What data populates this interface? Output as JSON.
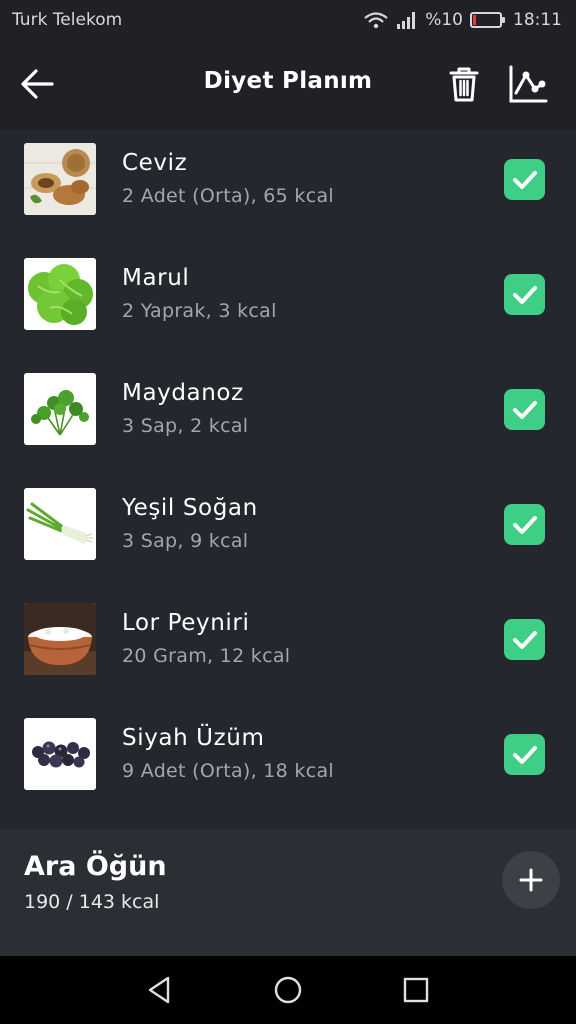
{
  "status_bar": {
    "carrier": "Turk Telekom",
    "battery_text": "%10",
    "battery_level": 0.1,
    "time": "18:11"
  },
  "header": {
    "title": "Diyet Planım",
    "back_icon": "arrow-left-icon",
    "delete_icon": "trash-icon",
    "stats_icon": "line-chart-icon"
  },
  "foods": [
    {
      "name": "Ceviz",
      "detail": "2 Adet (Orta), 65 kcal",
      "checked": true,
      "image": "walnut"
    },
    {
      "name": "Marul",
      "detail": "2 Yaprak, 3 kcal",
      "checked": true,
      "image": "lettuce"
    },
    {
      "name": "Maydanoz",
      "detail": "3 Sap, 2 kcal",
      "checked": true,
      "image": "parsley"
    },
    {
      "name": "Yeşil Soğan",
      "detail": "3 Sap, 9 kcal",
      "checked": true,
      "image": "green-onion"
    },
    {
      "name": "Lor Peyniri",
      "detail": "20 Gram, 12 kcal",
      "checked": true,
      "image": "cottage-cheese"
    },
    {
      "name": "Siyah Üzüm",
      "detail": "9 Adet (Orta), 18 kcal",
      "checked": true,
      "image": "black-grapes"
    }
  ],
  "meal": {
    "title": "Ara Öğün",
    "kcal": "190 / 143 kcal",
    "add_icon": "plus-icon"
  },
  "colors": {
    "background": "#25272e",
    "header": "#1f2126",
    "check": "#3fce86",
    "battery_low": "#e53935"
  },
  "nav": {
    "icons": [
      "back-triangle-icon",
      "home-circle-icon",
      "recents-square-icon"
    ]
  }
}
